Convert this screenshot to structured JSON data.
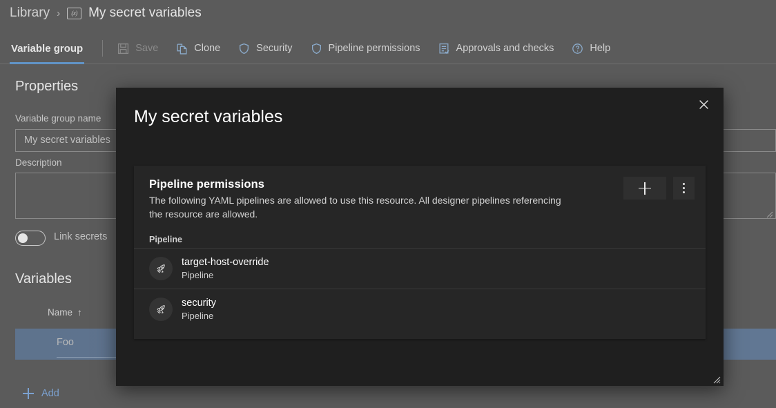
{
  "breadcrumb": {
    "root": "Library",
    "separator": "›",
    "icon": "variable-group-icon",
    "icon_glyph": "(x)",
    "current": "My secret variables"
  },
  "toolbar": {
    "active_tab": "Variable group",
    "buttons": [
      {
        "label": "Save",
        "icon": "save-icon",
        "disabled": true
      },
      {
        "label": "Clone",
        "icon": "clone-icon",
        "disabled": false
      },
      {
        "label": "Security",
        "icon": "shield-icon",
        "disabled": false
      },
      {
        "label": "Pipeline permissions",
        "icon": "shield-icon",
        "disabled": false
      },
      {
        "label": "Approvals and checks",
        "icon": "checklist-icon",
        "disabled": false
      },
      {
        "label": "Help",
        "icon": "help-circle-icon",
        "disabled": false
      }
    ]
  },
  "properties": {
    "section_title": "Properties",
    "name_label": "Variable group name",
    "name_value": "My secret variables",
    "description_label": "Description",
    "description_value": "",
    "link_secrets_label": "Link secrets",
    "link_secrets_on": false
  },
  "variables": {
    "section_title": "Variables",
    "column_header": "Name",
    "sort_glyph": "↑",
    "rows": [
      {
        "name": "Foo",
        "selected": true
      }
    ],
    "add_label": "Add"
  },
  "modal": {
    "title": "My secret variables",
    "close_label": "✕",
    "card": {
      "title": "Pipeline permissions",
      "description": "The following YAML pipelines are allowed to use this resource. All designer pipelines referencing the resource are allowed.",
      "add_button": "add-button",
      "more_button": "more-options-button",
      "column_header": "Pipeline",
      "items": [
        {
          "name": "target-host-override",
          "type": "Pipeline",
          "icon": "rocket-icon"
        },
        {
          "name": "security",
          "type": "Pipeline",
          "icon": "rocket-icon"
        }
      ]
    }
  },
  "colors": {
    "page_background": "#666666",
    "modal_background": "#1f1f1f",
    "card_background": "#262626",
    "accent_blue": "#6ca5de",
    "link_blue": "#8ab4e8",
    "selected_row": "#69809e"
  }
}
